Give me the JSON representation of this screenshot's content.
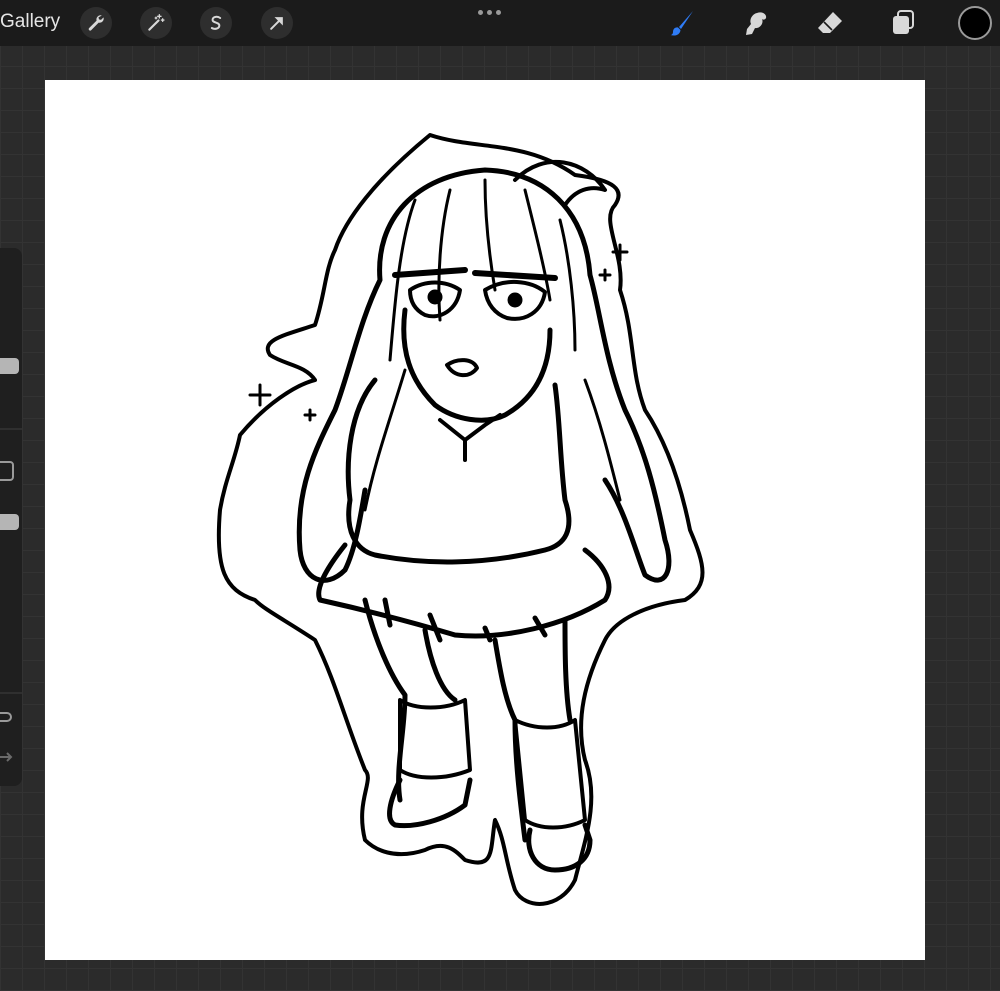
{
  "toolbar": {
    "gallery_label": "Gallery",
    "left_tools": [
      {
        "name": "actions",
        "icon": "wrench-icon"
      },
      {
        "name": "adjustments",
        "icon": "magic-wand-icon"
      },
      {
        "name": "selection",
        "icon": "selection-s-icon"
      },
      {
        "name": "transform",
        "icon": "arrow-cursor-icon"
      }
    ],
    "more_icon": "more-dots-icon",
    "right_tools": [
      {
        "name": "brush",
        "icon": "brush-icon",
        "active": true
      },
      {
        "name": "smudge",
        "icon": "smudge-icon",
        "active": false
      },
      {
        "name": "eraser",
        "icon": "eraser-icon",
        "active": false
      },
      {
        "name": "layers",
        "icon": "layers-icon",
        "active": false
      }
    ],
    "active_color": "#000000",
    "accent_color": "#2f7cf6"
  },
  "sidebar": {
    "brush_size_icon": "slider-thumb",
    "modify_icon": "square-icon",
    "opacity_icon": "slider-thumb",
    "undo_icon": "undo-arrow-icon",
    "redo_icon": "redo-arrow-icon"
  },
  "canvas": {
    "background": "#ffffff",
    "artwork": "line-art-sketch"
  }
}
